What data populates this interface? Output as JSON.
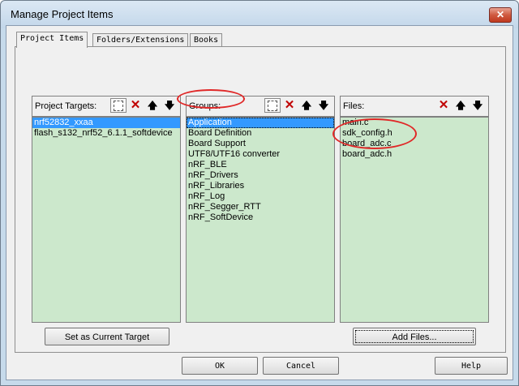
{
  "window": {
    "title": "Manage Project Items",
    "close_label": "✕"
  },
  "tabs": [
    {
      "label": "Project Items"
    },
    {
      "label": "Folders/Extensions"
    },
    {
      "label": "Books"
    }
  ],
  "targets": {
    "header": "Project Targets:",
    "items": [
      "nrf52832_xxaa",
      "flash_s132_nrf52_6.1.1_softdevice"
    ],
    "selected_index": 0
  },
  "groups": {
    "header": "Groups:",
    "items": [
      "Application",
      "Board Definition",
      "Board Support",
      "UTF8/UTF16 converter",
      "nRF_BLE",
      "nRF_Drivers",
      "nRF_Libraries",
      "nRF_Log",
      "nRF_Segger_RTT",
      "nRF_SoftDevice"
    ],
    "selected_index": 0
  },
  "files": {
    "header": "Files:",
    "items": [
      "main.c",
      "sdk_config.h",
      "board_adc.c",
      "board_adc.h"
    ]
  },
  "toolbar_icons": {
    "new": "new-item-icon",
    "delete": "delete-icon",
    "up": "move-up-icon",
    "down": "move-down-icon"
  },
  "buttons": {
    "set_current_target": "Set as Current Target",
    "add_files": "Add Files...",
    "ok": "OK",
    "cancel": "Cancel",
    "help": "Help"
  },
  "colors": {
    "list_background": "#cce8cc",
    "selection": "#3399ff",
    "annotation_ring": "#e02828"
  }
}
